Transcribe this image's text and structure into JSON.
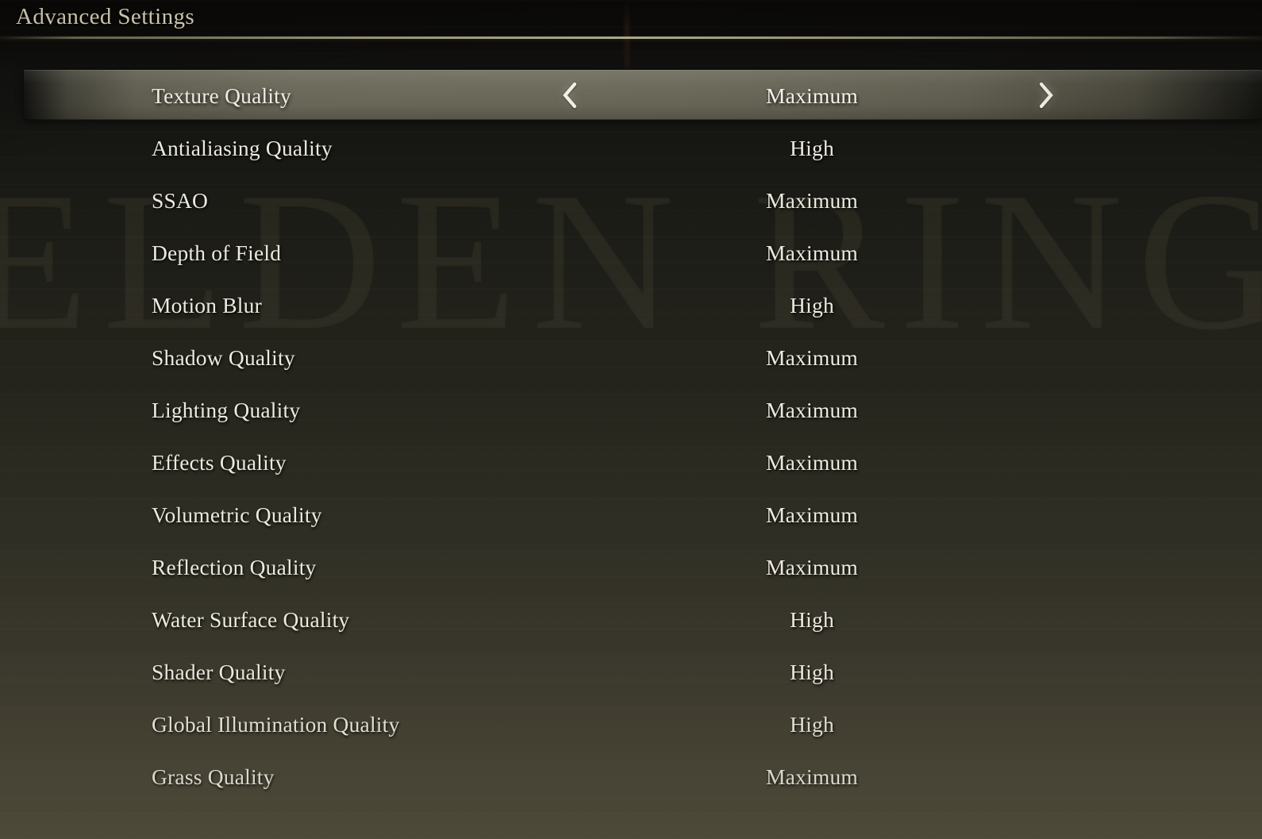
{
  "header": {
    "title": "Advanced Settings"
  },
  "background": {
    "watermark_text": "ELDEN RING"
  },
  "controls": {
    "prev_icon": "chevron-left-icon",
    "next_icon": "chevron-right-icon"
  },
  "colors": {
    "title_text": "#ddd5bd",
    "row_text": "#eceade",
    "selected_row_bg": "#6a6859",
    "divider": "#bab696",
    "page_bg_top": "#090806",
    "page_bg_bottom": "#4a4738"
  },
  "settings": {
    "selected_index": 0,
    "rows": [
      {
        "label": "Texture Quality",
        "value": "Maximum"
      },
      {
        "label": "Antialiasing Quality",
        "value": "High"
      },
      {
        "label": "SSAO",
        "value": "Maximum"
      },
      {
        "label": "Depth of Field",
        "value": "Maximum"
      },
      {
        "label": "Motion Blur",
        "value": "High"
      },
      {
        "label": "Shadow Quality",
        "value": "Maximum"
      },
      {
        "label": "Lighting Quality",
        "value": "Maximum"
      },
      {
        "label": "Effects Quality",
        "value": "Maximum"
      },
      {
        "label": "Volumetric Quality",
        "value": "Maximum"
      },
      {
        "label": "Reflection Quality",
        "value": "Maximum"
      },
      {
        "label": "Water Surface Quality",
        "value": "High"
      },
      {
        "label": "Shader Quality",
        "value": "High"
      },
      {
        "label": "Global Illumination Quality",
        "value": "High"
      },
      {
        "label": "Grass Quality",
        "value": "Maximum"
      }
    ]
  }
}
